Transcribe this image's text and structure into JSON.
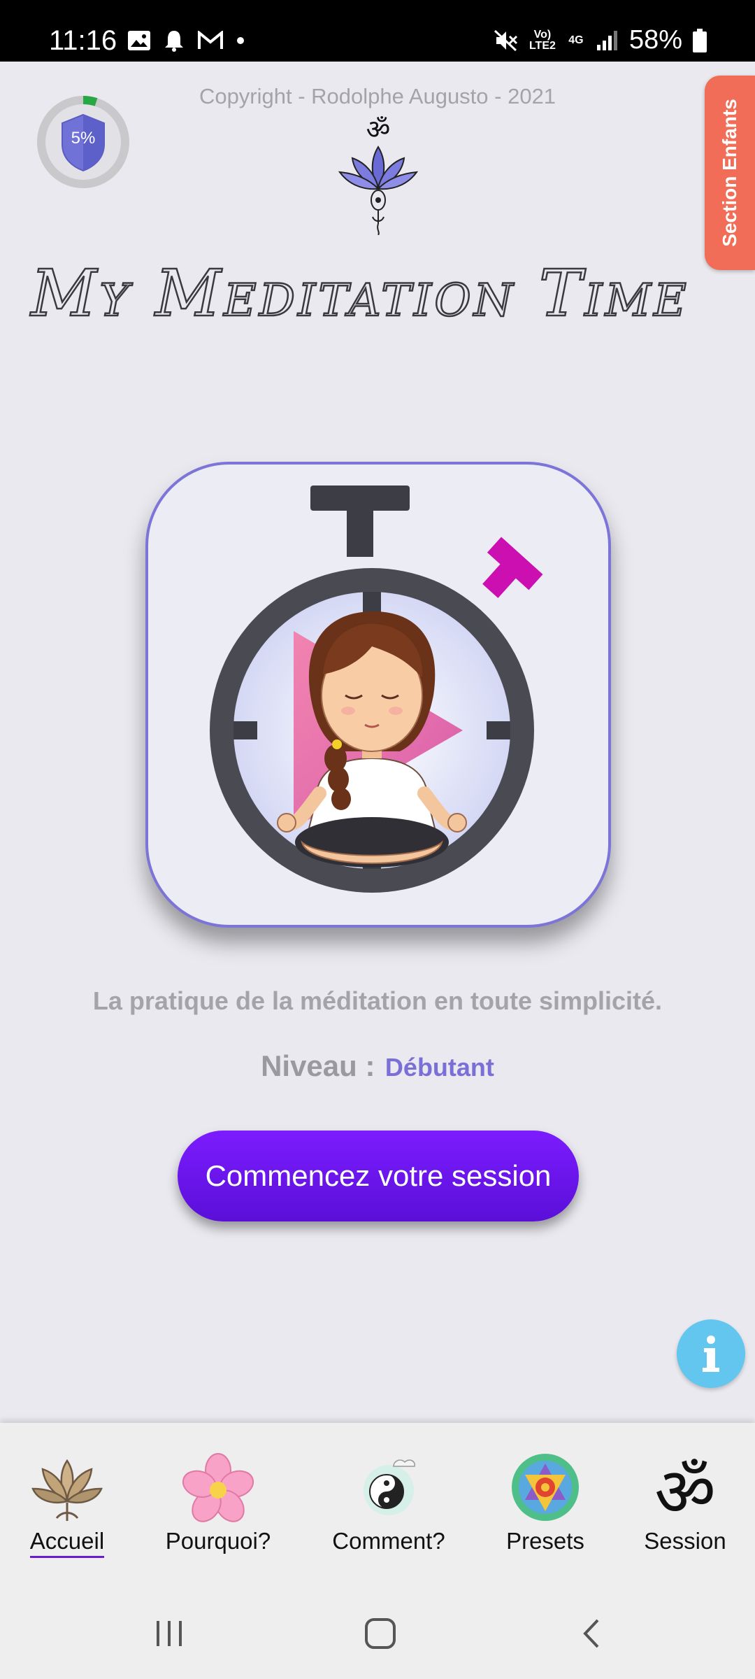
{
  "status_bar": {
    "time": "11:16",
    "battery": "58%",
    "icons": [
      "image-icon",
      "bell-icon",
      "gmail-icon",
      "dot-icon",
      "mute-icon",
      "volte-icon",
      "4g-icon",
      "signal-icon",
      "battery-icon"
    ],
    "volte_label": "Vo) LTE2",
    "network_label": "4G"
  },
  "header": {
    "copyright": "Copyright - Rodolphe Augusto - 2021",
    "progress_percent": 5,
    "progress_label": "5%",
    "side_tab_label": "Section Enfants",
    "title": "My Meditation Time"
  },
  "main": {
    "tagline": "La pratique de la méditation en toute simplicité.",
    "level_label": "Niveau :",
    "level_value": "Débutant",
    "start_button": "Commencez votre session"
  },
  "bottom_nav": {
    "items": [
      {
        "label": "Accueil",
        "icon": "lotus-icon",
        "active": true
      },
      {
        "label": "Pourquoi?",
        "icon": "flower-icon",
        "active": false
      },
      {
        "label": "Comment?",
        "icon": "yin-yang-icon",
        "active": false
      },
      {
        "label": "Presets",
        "icon": "mandala-icon",
        "active": false
      },
      {
        "label": "Session",
        "icon": "om-icon",
        "active": false
      }
    ]
  },
  "colors": {
    "accent": "#6a12e8",
    "side_tab": "#f26d57",
    "level": "#7a6fd6",
    "info": "#62c6ee"
  }
}
